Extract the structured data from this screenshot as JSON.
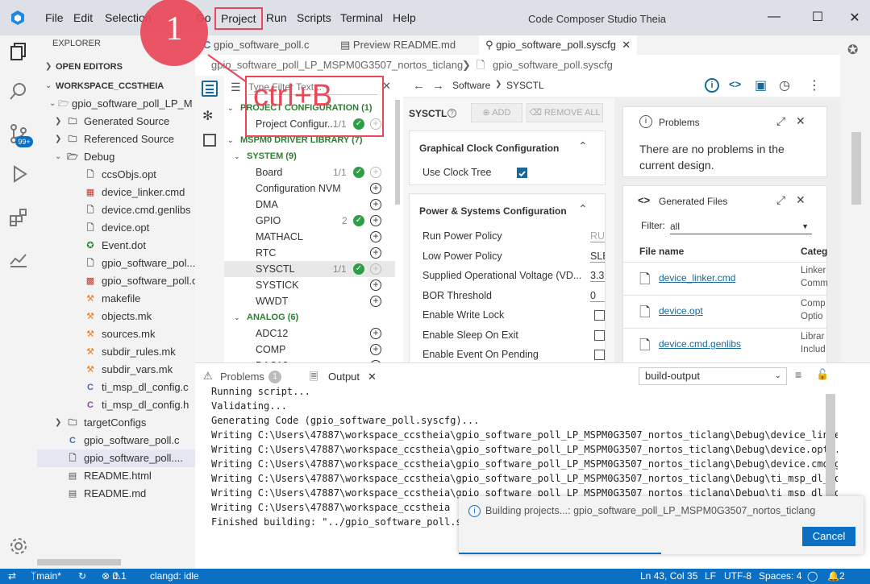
{
  "titlebar": {
    "menus": [
      "File",
      "Edit",
      "Selection",
      "Go",
      "Project",
      "Run",
      "Scripts",
      "Terminal",
      "Help"
    ],
    "window_title": "Code Composer Studio Theia"
  },
  "annotation": {
    "step": "1",
    "shortcut": "ctrl+B"
  },
  "explorer": {
    "title": "EXPLORER",
    "open_editors": "OPEN EDITORS",
    "workspace": "WORKSPACE_CCSTHEIA",
    "project": "gpio_software_poll_LP_M",
    "items": [
      {
        "label": "Generated Source",
        "type": "folder"
      },
      {
        "label": "Referenced Source",
        "type": "folder"
      },
      {
        "label": "Debug",
        "type": "folder-open"
      },
      {
        "label": "ccsObjs.opt",
        "type": "file"
      },
      {
        "label": "device_linker.cmd",
        "type": "cmd"
      },
      {
        "label": "device.cmd.genlibs",
        "type": "file"
      },
      {
        "label": "device.opt",
        "type": "file"
      },
      {
        "label": "Event.dot",
        "type": "dot"
      },
      {
        "label": "gpio_software_pol...",
        "type": "file"
      },
      {
        "label": "gpio_software_poll.o",
        "type": "obj"
      },
      {
        "label": "makefile",
        "type": "make"
      },
      {
        "label": "objects.mk",
        "type": "make"
      },
      {
        "label": "sources.mk",
        "type": "make"
      },
      {
        "label": "subdir_rules.mk",
        "type": "make"
      },
      {
        "label": "subdir_vars.mk",
        "type": "make"
      },
      {
        "label": "ti_msp_dl_config.c",
        "type": "c"
      },
      {
        "label": "ti_msp_dl_config.h",
        "type": "h"
      },
      {
        "label": "targetConfigs",
        "type": "folder"
      },
      {
        "label": "gpio_software_poll.c",
        "type": "c"
      },
      {
        "label": "gpio_software_poll....",
        "type": "file"
      },
      {
        "label": "README.html",
        "type": "html"
      },
      {
        "label": "README.md",
        "type": "md"
      }
    ],
    "badge": "99+"
  },
  "tabs": [
    {
      "label": "gpio_software_poll.c"
    },
    {
      "label": "Preview README.md"
    },
    {
      "label": "gpio_software_poll.syscfg"
    }
  ],
  "breadcrumb": {
    "project": "gpio_software_poll_LP_MSPM0G3507_nortos_ticlang",
    "file": "gpio_software_poll.syscfg"
  },
  "sysconfig": {
    "filter_placeholder": "Type Filter Text...",
    "nav": {
      "a": "Software",
      "b": "SYSCTL"
    },
    "tree": [
      {
        "label": "PROJECT CONFIGURATION (1)",
        "kind": "grp"
      },
      {
        "label": "Project Configur...",
        "count": "1/1",
        "kind": "item"
      },
      {
        "label": "MSPM0 DRIVER LIBRARY (7)",
        "kind": "grp"
      },
      {
        "label": "SYSTEM (9)",
        "kind": "grp"
      },
      {
        "label": "Board",
        "count": "1/1",
        "kind": "item"
      },
      {
        "label": "Configuration NVM",
        "count": "",
        "kind": "item"
      },
      {
        "label": "DMA",
        "count": "",
        "kind": "item"
      },
      {
        "label": "GPIO",
        "count": "2",
        "kind": "item"
      },
      {
        "label": "MATHACL",
        "count": "",
        "kind": "item"
      },
      {
        "label": "RTC",
        "count": "",
        "kind": "item"
      },
      {
        "label": "SYSCTL",
        "count": "1/1",
        "kind": "item"
      },
      {
        "label": "SYSTICK",
        "count": "",
        "kind": "item"
      },
      {
        "label": "WWDT",
        "count": "",
        "kind": "item"
      },
      {
        "label": "ANALOG (6)",
        "kind": "grp"
      },
      {
        "label": "ADC12",
        "count": "",
        "kind": "item"
      },
      {
        "label": "COMP",
        "count": "",
        "kind": "item"
      },
      {
        "label": "DAC12",
        "count": "",
        "kind": "item"
      }
    ],
    "module_title": "SYSCTL",
    "add_label": "ADD",
    "remove_all_label": "REMOVE ALL",
    "clock_panel": {
      "title": "Graphical Clock Configuration",
      "use_clock_tree": "Use Clock Tree"
    },
    "power_panel": {
      "title": "Power & Systems Configuration",
      "rows": [
        {
          "label": "Run Power Policy",
          "value": "RU"
        },
        {
          "label": "Low Power Policy",
          "value": "SLE"
        },
        {
          "label": "Supplied Operational Voltage (VD...",
          "value": "3.3"
        },
        {
          "label": "BOR Threshold",
          "value": "0"
        },
        {
          "label": "Enable Write Lock",
          "value": ""
        },
        {
          "label": "Enable Sleep On Exit",
          "value": ""
        },
        {
          "label": "Enable Event On Pending",
          "value": ""
        }
      ]
    },
    "problems": {
      "title": "Problems",
      "text": "There are no problems in the current design."
    },
    "generated": {
      "title": "Generated Files",
      "filter_label": "Filter:",
      "filter_value": "all",
      "col_file": "File name",
      "col_cat": "Categ",
      "files": [
        {
          "name": "device_linker.cmd",
          "cat1": "Linker",
          "cat2": "Comm"
        },
        {
          "name": "device.opt",
          "cat1": "Comp",
          "cat2": "Optio"
        },
        {
          "name": "device.cmd.genlibs",
          "cat1": "Librar",
          "cat2": "Includ"
        }
      ]
    }
  },
  "bottom": {
    "problems_tab": "Problems",
    "problems_count": "1",
    "output_tab": "Output",
    "channel": "build-output",
    "lines": [
      "Running script...",
      "Validating...",
      "Generating Code (gpio_software_poll.syscfg)...",
      "Writing C:\\Users\\47887\\workspace_ccstheia\\gpio_software_poll_LP_MSPM0G3507_nortos_ticlang\\Debug\\device_linker",
      "Writing C:\\Users\\47887\\workspace_ccstheia\\gpio_software_poll_LP_MSPM0G3507_nortos_ticlang\\Debug\\device.opt...",
      "Writing C:\\Users\\47887\\workspace_ccstheia\\gpio_software_poll_LP_MSPM0G3507_nortos_ticlang\\Debug\\device.cmd.ge",
      "Writing C:\\Users\\47887\\workspace_ccstheia\\gpio_software_poll_LP_MSPM0G3507_nortos_ticlang\\Debug\\ti_msp_dl_cor",
      "Writing C:\\Users\\47887\\workspace_ccstheia\\gpio_software_poll_LP_MSPM0G3507_nortos_ticlang\\Debug\\ti_msp_dl_cor",
      "Writing C:\\Users\\47887\\workspace_ccstheia",
      "Finished building: \"../gpio_software_poll.s"
    ]
  },
  "notification": {
    "text": "Building projects...: gpio_software_poll_LP_MSPM0G3507_nortos_ticlang",
    "cancel": "Cancel"
  },
  "status": {
    "branch": "main*",
    "errors": "0",
    "warnings": "1",
    "clangd": "clangd: idle",
    "position": "Ln 43, Col 35",
    "eol": "LF",
    "encoding": "UTF-8",
    "indent": "Spaces: 4",
    "notif": "2"
  },
  "colors": {
    "accent": "#0b6fc4",
    "annotation": "#e84858",
    "ok": "#2e9e48"
  }
}
